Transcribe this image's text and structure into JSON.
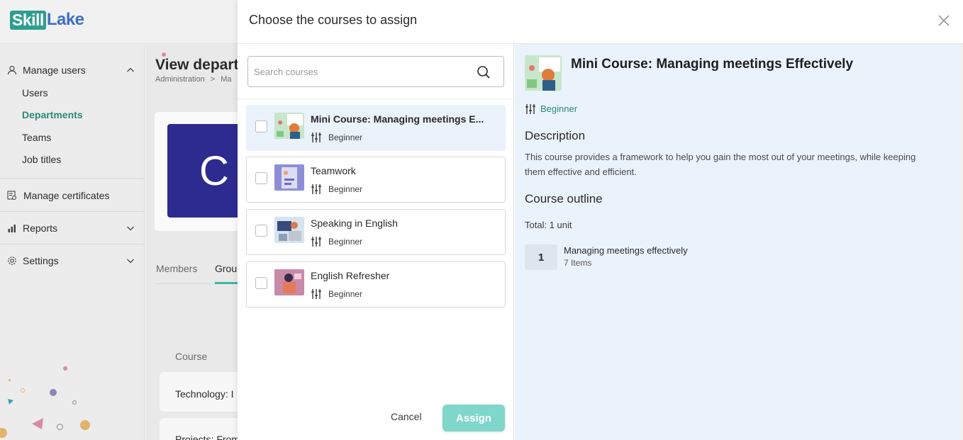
{
  "app": {
    "logo_part1": "Skill",
    "logo_part2": "Lake",
    "brand_color": "#2f9e8f"
  },
  "sidebar": {
    "manage_users": {
      "label": "Manage users",
      "icon": "user-icon",
      "items": [
        {
          "label": "Users"
        },
        {
          "label": "Departments",
          "active": true
        },
        {
          "label": "Teams"
        },
        {
          "label": "Job titles"
        }
      ]
    },
    "manage_certificates": {
      "label": "Manage certificates",
      "icon": "certificate-icon"
    },
    "reports": {
      "label": "Reports",
      "icon": "chart-icon"
    },
    "settings": {
      "label": "Settings",
      "icon": "gear-icon"
    }
  },
  "background_page": {
    "title": "View depart",
    "breadcrumb": {
      "first": "Administration",
      "separator": ">",
      "second": "Ma"
    },
    "avatar_letter": "C",
    "tabs": [
      {
        "label": "Members"
      },
      {
        "label": "Grou"
      }
    ],
    "column_header": "Course",
    "rows": [
      {
        "text": "Technology: I"
      },
      {
        "text": "Projects: From"
      }
    ]
  },
  "modal": {
    "title": "Choose the courses to assign",
    "search": {
      "placeholder": "Search courses",
      "value": ""
    },
    "courses": [
      {
        "name": "Mini Course: Managing meetings E...",
        "level": "Beginner",
        "selected": true
      },
      {
        "name": "Teamwork",
        "level": "Beginner",
        "selected": false
      },
      {
        "name": "Speaking in English",
        "level": "Beginner",
        "selected": false
      },
      {
        "name": "English Refresher",
        "level": "Beginner",
        "selected": false
      }
    ],
    "cancel_label": "Cancel",
    "assign_label": "Assign",
    "accent_color": "#7fd6cb"
  },
  "detail": {
    "title": "Mini Course: Managing meetings Effectively",
    "level": "Beginner",
    "description_heading": "Description",
    "description": "This course provides a framework to help you gain the most out of your meetings, while keeping them effective and efficient.",
    "outline_heading": "Course outline",
    "total": "Total: 1 unit",
    "units": [
      {
        "number": "1",
        "name": "Managing meetings effectively",
        "items": "7 Items"
      }
    ]
  }
}
